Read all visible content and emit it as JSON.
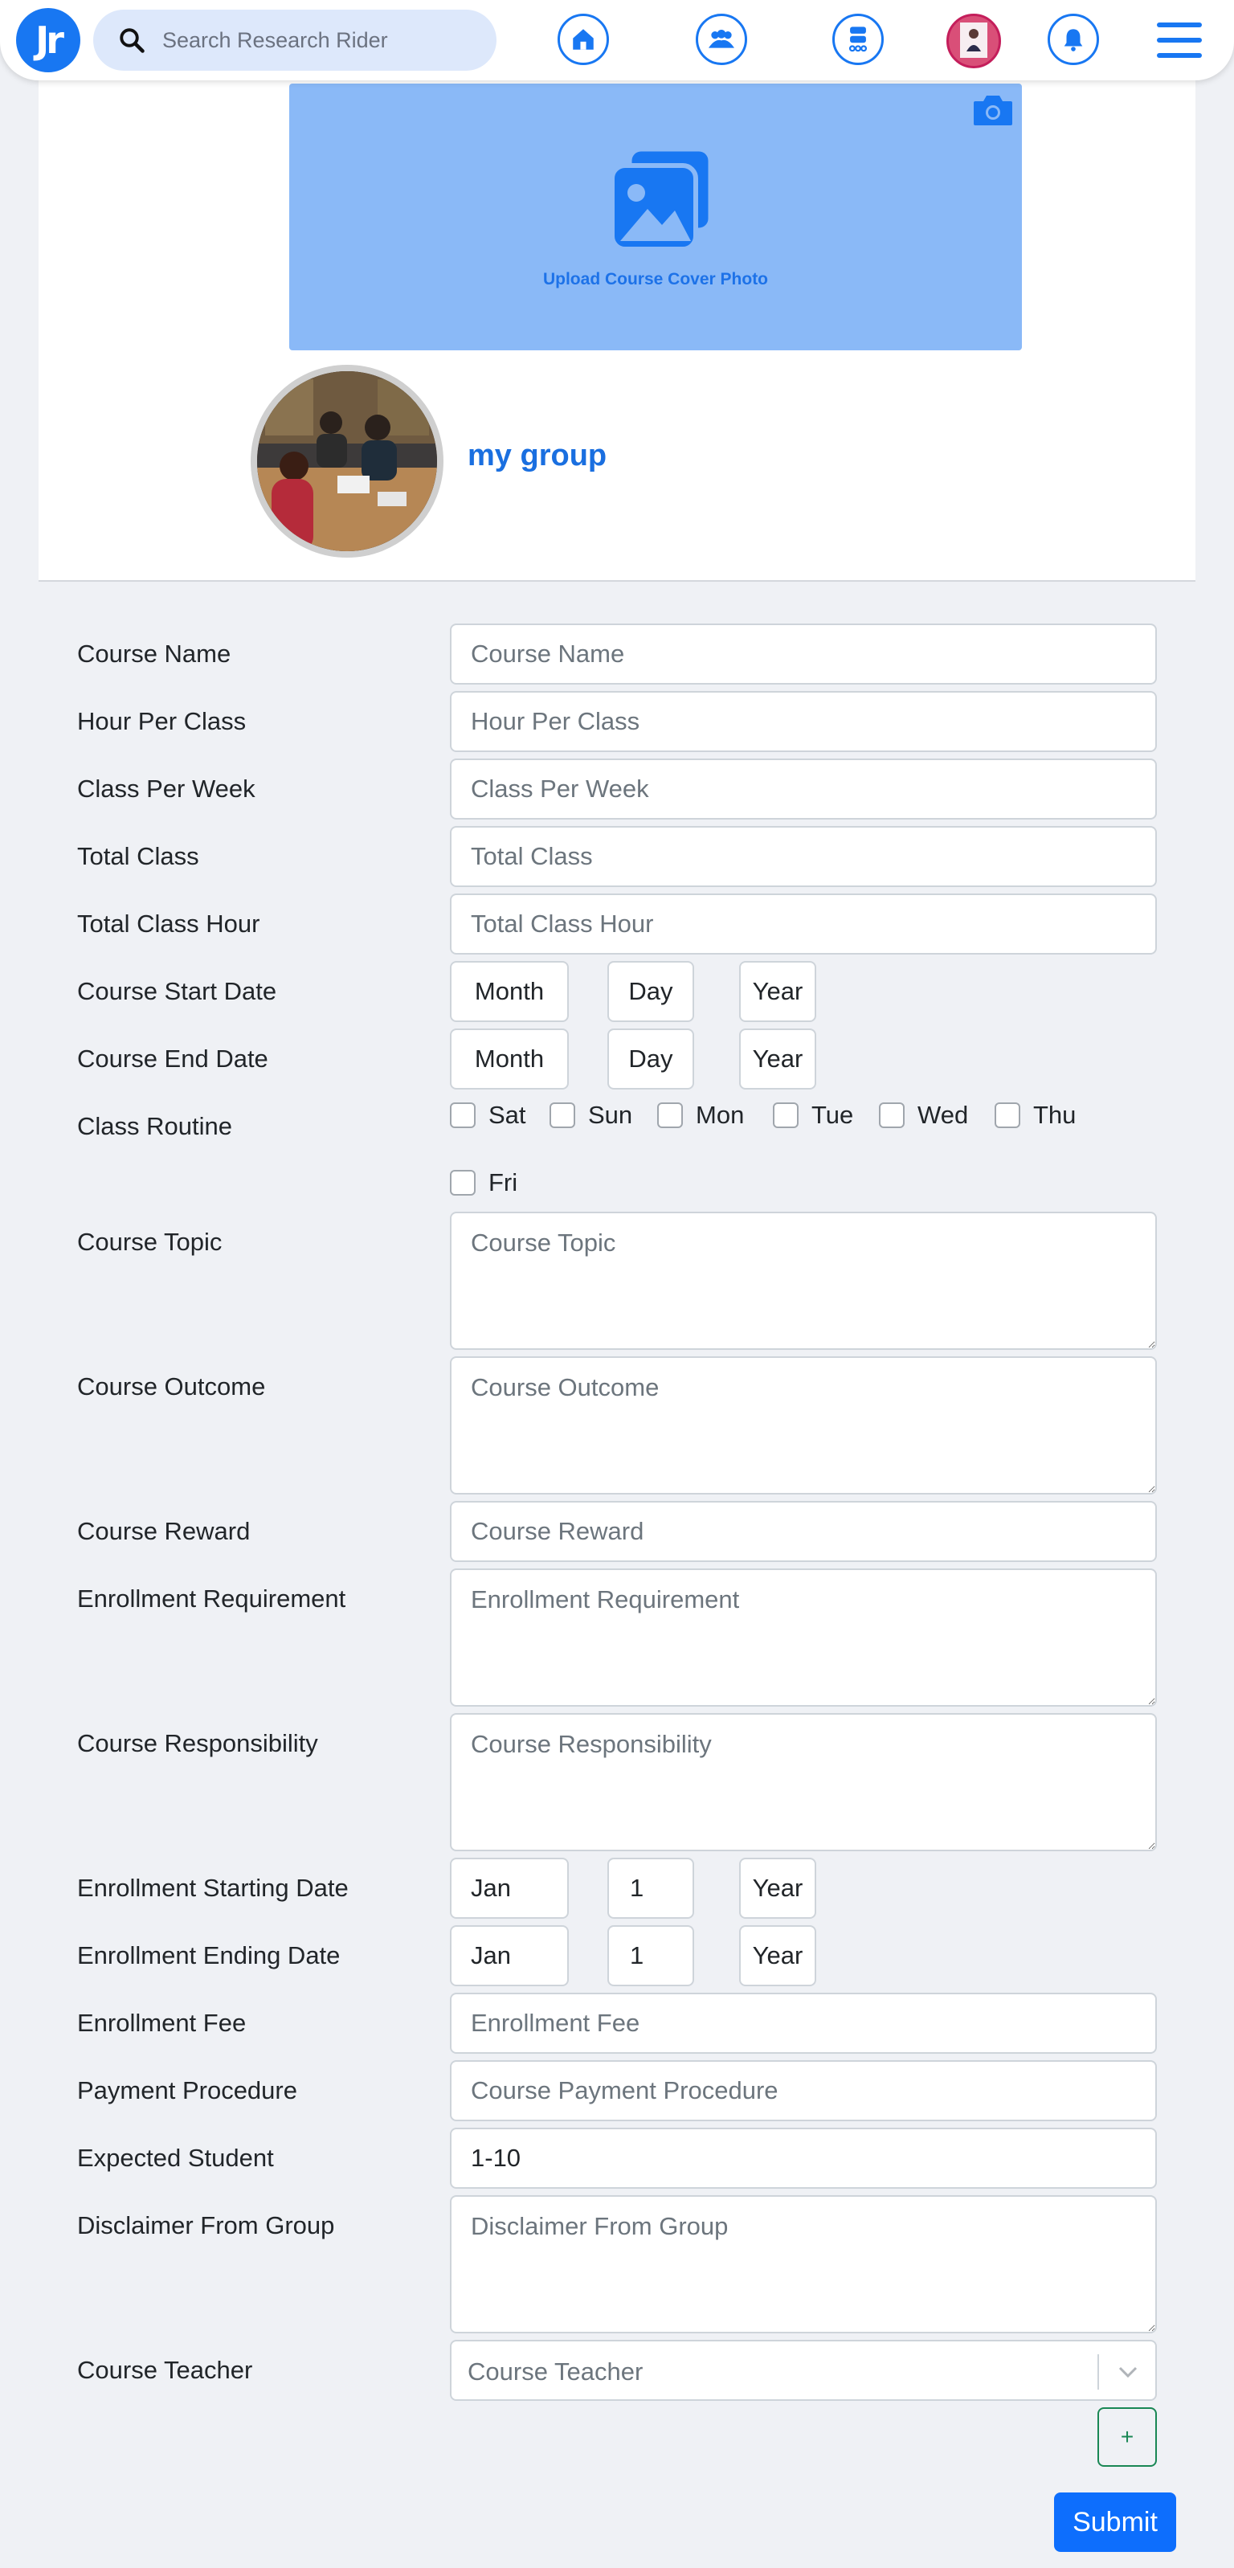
{
  "nav": {
    "logo_text": "Jr",
    "search_placeholder": "Search Research Rider",
    "icons": [
      "home-icon",
      "groups-icon",
      "courses-icon",
      "profile-avatar",
      "bell-icon",
      "menu-icon"
    ]
  },
  "header": {
    "cover_label": "Upload Course Cover Photo",
    "group_name": "my group"
  },
  "form": {
    "course_name": {
      "label": "Course Name",
      "placeholder": "Course Name"
    },
    "hour_per_class": {
      "label": "Hour Per Class",
      "placeholder": "Hour Per Class"
    },
    "class_per_week": {
      "label": "Class Per Week",
      "placeholder": "Class Per Week"
    },
    "total_class": {
      "label": "Total Class",
      "placeholder": "Total Class"
    },
    "total_class_hour": {
      "label": "Total Class Hour",
      "placeholder": "Total Class Hour"
    },
    "course_start_date": {
      "label": "Course Start Date",
      "month": "Month",
      "day": "Day",
      "year": "Year"
    },
    "course_end_date": {
      "label": "Course End Date",
      "month": "Month",
      "day": "Day",
      "year": "Year"
    },
    "class_routine": {
      "label": "Class Routine",
      "days": [
        "Sat",
        "Sun",
        "Mon",
        "Tue",
        "Wed",
        "Thu",
        "Fri"
      ]
    },
    "course_topic": {
      "label": "Course Topic",
      "placeholder": "Course Topic"
    },
    "course_outcome": {
      "label": "Course Outcome",
      "placeholder": "Course Outcome"
    },
    "course_reward": {
      "label": "Course Reward",
      "placeholder": "Course Reward"
    },
    "enrollment_requirement": {
      "label": "Enrollment Requirement",
      "placeholder": "Enrollment Requirement"
    },
    "course_responsibility": {
      "label": "Course Responsibility",
      "placeholder": "Course Responsibility"
    },
    "enrollment_start": {
      "label": "Enrollment Starting Date",
      "month": "Jan",
      "day": "1",
      "year": "Year"
    },
    "enrollment_end": {
      "label": "Enrollment Ending Date",
      "month": "Jan",
      "day": "1",
      "year": "Year"
    },
    "enrollment_fee": {
      "label": "Enrollment Fee",
      "placeholder": "Enrollment Fee"
    },
    "payment_procedure": {
      "label": "Payment Procedure",
      "placeholder": "Course Payment Procedure"
    },
    "expected_student": {
      "label": "Expected Student",
      "value": "1-10"
    },
    "disclaimer": {
      "label": "Disclaimer From Group",
      "placeholder": "Disclaimer From Group"
    },
    "course_teacher": {
      "label": "Course Teacher",
      "placeholder": "Course Teacher"
    },
    "add_label": "+",
    "submit_label": "Submit"
  },
  "colors": {
    "primary": "#1877f2",
    "cover_bg": "#8ab9f7",
    "submit": "#0d6efd",
    "add_border": "#198754"
  }
}
